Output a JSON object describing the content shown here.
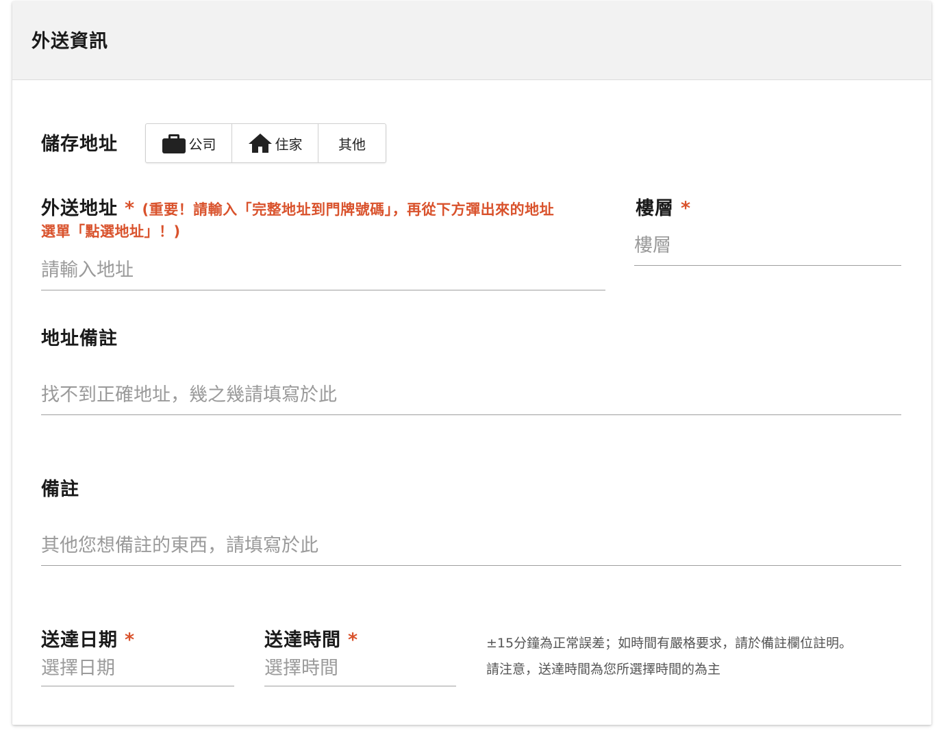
{
  "header": {
    "title": "外送資訊"
  },
  "saved_address": {
    "label": "儲存地址",
    "options": [
      {
        "label": "公司",
        "icon": "briefcase-icon"
      },
      {
        "label": "住家",
        "icon": "home-icon"
      },
      {
        "label": "其他"
      }
    ]
  },
  "address": {
    "label": "外送地址",
    "required": "*",
    "warning_line1": "(重要！請輸入「完整地址到門牌號碼」，再從下方彈出來的地址",
    "warning_line2": "選單「點選地址」！)",
    "placeholder": "請輸入地址",
    "value": ""
  },
  "floor": {
    "label": "樓層",
    "required": "*",
    "placeholder": "樓層",
    "value": ""
  },
  "address_note": {
    "label": "地址備註",
    "placeholder": "找不到正確地址，幾之幾請填寫於此",
    "value": ""
  },
  "note": {
    "label": "備註",
    "placeholder": "其他您想備註的東西，請填寫於此",
    "value": ""
  },
  "delivery_date": {
    "label": "送達日期",
    "required": "*",
    "placeholder": "選擇日期",
    "value": ""
  },
  "delivery_time": {
    "label": "送達時間",
    "required": "*",
    "placeholder": "選擇時間",
    "value": ""
  },
  "time_hint": {
    "line1": "±15分鐘為正常誤差；如時間有嚴格要求，請於備註欄位註明。",
    "line2": "請注意，送達時間為您所選擇時間的為主"
  },
  "colors": {
    "accent": "#d9522c",
    "header_bg": "#f2f2f2",
    "border": "#9e9e9e",
    "placeholder": "#9a9a9a"
  }
}
